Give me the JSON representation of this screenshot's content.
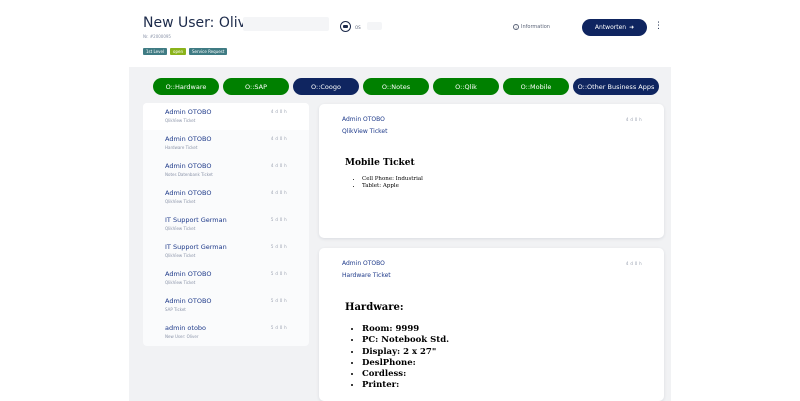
{
  "header": {
    "title": "New User: Oliver",
    "ticket_number": "Nr. #2000095",
    "tags": [
      {
        "label": "1st Level",
        "color": "#3f7b83"
      },
      {
        "label": "open",
        "color": "#8ab31b"
      },
      {
        "label": "Service Request",
        "color": "#3f7b83"
      }
    ],
    "owner": "OS",
    "info_label": "Information",
    "reply_label": "Antworten",
    "reply_icon": "arrow-right-icon",
    "menu_icon": "vertical-dots-icon"
  },
  "apps": [
    {
      "label": "O::Hardware",
      "color": "#008000"
    },
    {
      "label": "O::SAP",
      "color": "#008000"
    },
    {
      "label": "O::Coogo",
      "color": "#0f2560"
    },
    {
      "label": "O::Notes",
      "color": "#008000"
    },
    {
      "label": "O::Qlik",
      "color": "#008000"
    },
    {
      "label": "O::Mobile",
      "color": "#008000"
    },
    {
      "label": "O::Other Business Apps",
      "color": "#0f2560"
    }
  ],
  "articles": [
    {
      "sender": "Admin OTOBO",
      "subject": "QlikView Ticket",
      "time": "4 d 0 h"
    },
    {
      "sender": "Admin OTOBO",
      "subject": "Hardware Ticket",
      "time": "4 d 0 h"
    },
    {
      "sender": "Admin OTOBO",
      "subject": "Notes Datenbank Ticket",
      "time": "4 d 0 h"
    },
    {
      "sender": "Admin OTOBO",
      "subject": "QlikView Ticket",
      "time": "4 d 0 h"
    },
    {
      "sender": "IT Support German",
      "subject": "QlikView Ticket",
      "time": "5 d 0 h"
    },
    {
      "sender": "IT Support German",
      "subject": "QlikView Ticket",
      "time": "5 d 0 h"
    },
    {
      "sender": "Admin OTOBO",
      "subject": "QlikView Ticket",
      "time": "5 d 0 h"
    },
    {
      "sender": "Admin OTOBO",
      "subject": "SAP Ticket",
      "time": "5 d 0 h"
    },
    {
      "sender": "admin otobo",
      "subject": "New User: Oliver",
      "time": "5 d 0 h"
    }
  ],
  "detail": [
    {
      "sender": "Admin OTOBO",
      "subject": "QlikView Ticket",
      "time": "4 d 0 h",
      "heading": "Mobile Ticket",
      "items": [
        "Cell Phone: Industrial",
        "Tablet: Apple"
      ]
    },
    {
      "sender": "Admin OTOBO",
      "subject": "Hardware Ticket",
      "time": "4 d 0 h",
      "heading": "Hardware:",
      "items": [
        "Room: 9999",
        "PC: Notebook Std.",
        "Display: 2 x 27\"",
        "DeslPhone:",
        "Cordless:",
        "Printer:"
      ]
    }
  ]
}
